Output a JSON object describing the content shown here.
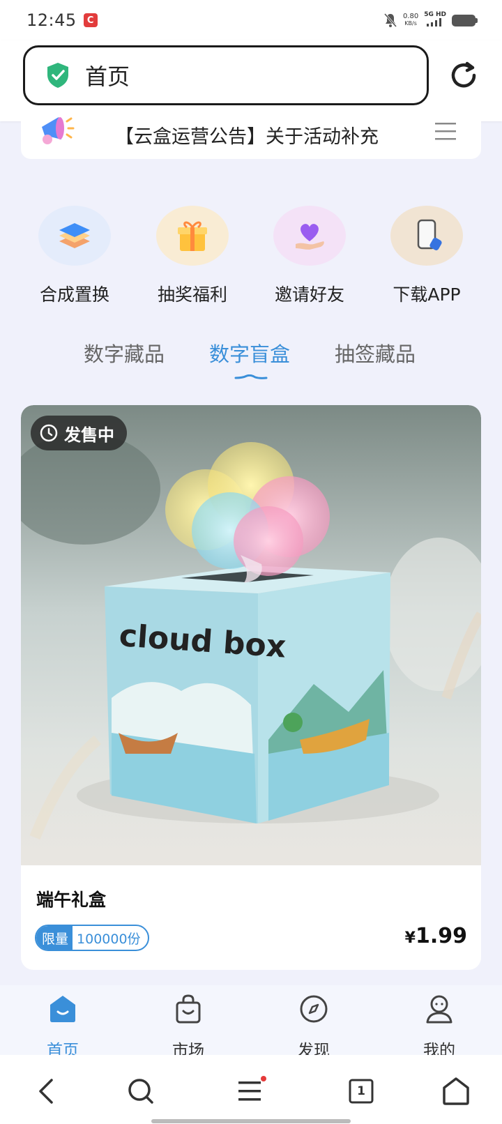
{
  "status_bar": {
    "time": "12:45",
    "net_speed": "0.80",
    "net_unit": "KB/s",
    "network": "5G HD"
  },
  "browser": {
    "url_text": "首页"
  },
  "notice": {
    "text": "【云盒运营公告】关于活动补充"
  },
  "quick_actions": [
    {
      "label": "合成置换",
      "icon": "layers-icon",
      "bg": "#e4ecfb"
    },
    {
      "label": "抽奖福利",
      "icon": "gift-box-icon",
      "bg": "#f9ecd4"
    },
    {
      "label": "邀请好友",
      "icon": "heart-hand-icon",
      "bg": "#f4e2f7"
    },
    {
      "label": "下载APP",
      "icon": "phone-icon",
      "bg": "#f1e4d3"
    }
  ],
  "tabs": [
    {
      "label": "数字藏品",
      "active": false
    },
    {
      "label": "数字盲盒",
      "active": true
    },
    {
      "label": "抽签藏品",
      "active": false
    }
  ],
  "product": {
    "status_badge": "发售中",
    "box_text": "cloud box",
    "title": "端午礼盒",
    "limit_label": "限量",
    "limit_value": "100000份",
    "currency": "¥",
    "price": "1.99"
  },
  "bottom_nav": [
    {
      "label": "首页",
      "icon": "home-icon",
      "active": true
    },
    {
      "label": "市场",
      "icon": "shopping-bag-icon",
      "active": false
    },
    {
      "label": "发现",
      "icon": "compass-icon",
      "active": false
    },
    {
      "label": "我的",
      "icon": "user-icon",
      "active": false
    }
  ],
  "system_nav": {
    "tab_count": "1"
  },
  "colors": {
    "accent": "#3a8fd9",
    "page_bg": "#f0f1fb",
    "shield": "#2fb67c"
  }
}
